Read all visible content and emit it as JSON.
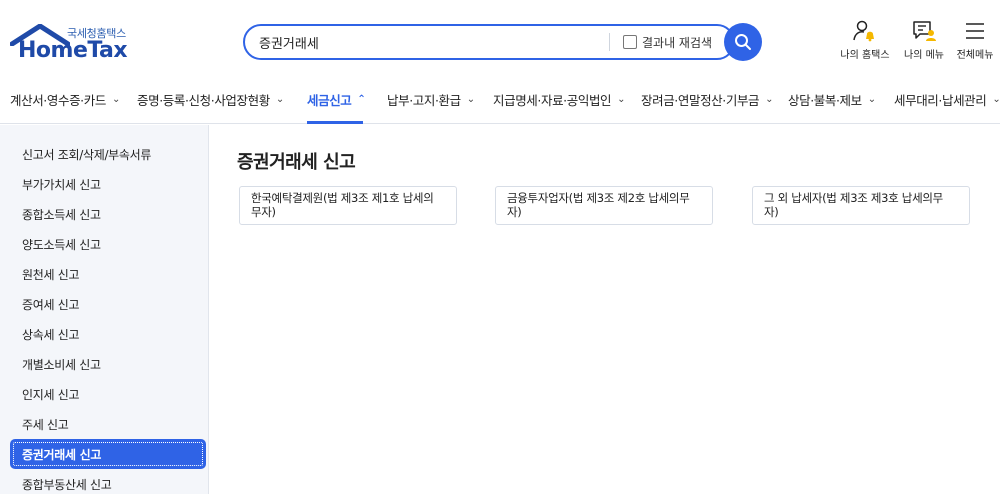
{
  "header": {
    "logo": {
      "korean": "국세청홈택스",
      "english": "HomeTax"
    },
    "search": {
      "value": "증권거래세",
      "recheck_label": "결과내 재검색"
    },
    "utils": [
      {
        "label": "나의 홈택스",
        "icon": "person-bell-icon"
      },
      {
        "label": "나의 메뉴",
        "icon": "my-menu-icon"
      },
      {
        "label": "전체메뉴",
        "icon": "hamburger-icon"
      }
    ]
  },
  "gnb": [
    {
      "label": "계산서·영수증·카드"
    },
    {
      "label": "증명·등록·신청·사업장현황"
    },
    {
      "label": "세금신고",
      "active": true
    },
    {
      "label": "납부·고지·환급"
    },
    {
      "label": "지급명세·자료·공익법인"
    },
    {
      "label": "장려금·연말정산·기부금"
    },
    {
      "label": "상담·불복·제보"
    },
    {
      "label": "세무대리·납세관리"
    }
  ],
  "sidebar": {
    "items": [
      {
        "label": "신고서 조회/삭제/부속서류"
      },
      {
        "label": "부가가치세 신고"
      },
      {
        "label": "종합소득세 신고"
      },
      {
        "label": "양도소득세 신고"
      },
      {
        "label": "원천세 신고"
      },
      {
        "label": "증여세 신고"
      },
      {
        "label": "상속세 신고"
      },
      {
        "label": "개별소비세 신고"
      },
      {
        "label": "인지세 신고"
      },
      {
        "label": "주세 신고"
      },
      {
        "label": "증권거래세 신고",
        "active": true
      },
      {
        "label": "종합부동산세 신고"
      }
    ]
  },
  "main": {
    "title": "증권거래세 신고",
    "cards": [
      {
        "line1": "한국예탁결제원(법 제3조 제1호 납세의",
        "line2": "무자)"
      },
      {
        "line1": "금융투자업자(법 제3조 제2호 납세의무",
        "line2": "자)"
      },
      {
        "line1": "그 외 납세자(법 제3조 제3호 납세의무",
        "line2": "자)"
      }
    ]
  },
  "colors": {
    "accent": "#2f63e6",
    "logo": "#1f4aa8",
    "sidebar_bg": "#f4f6fa",
    "bell": "#f5b800"
  }
}
